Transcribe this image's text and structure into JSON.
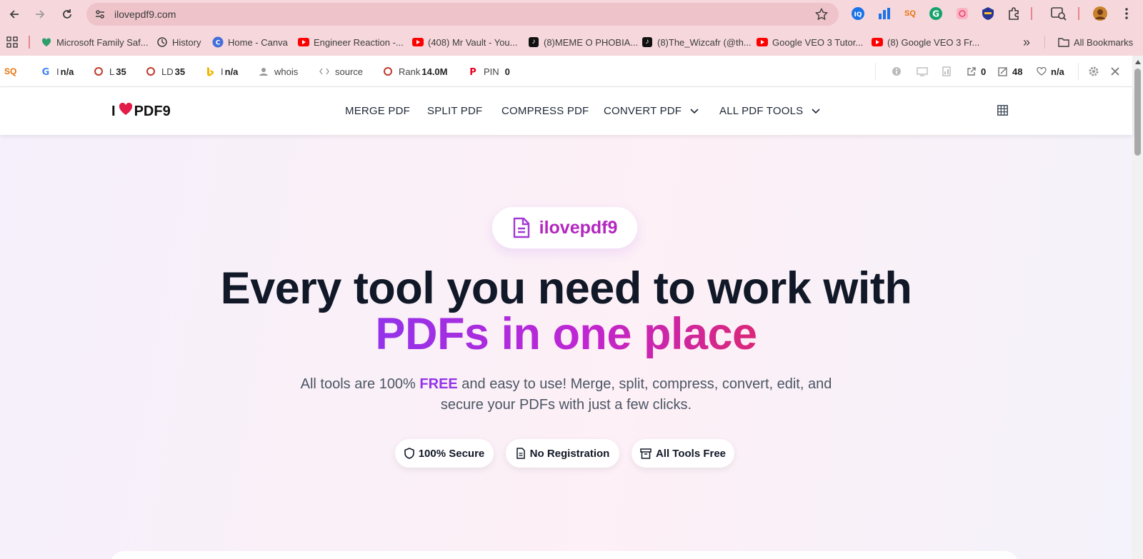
{
  "browser": {
    "url": "ilovepdf9.com",
    "bookmarks": [
      {
        "label": "Microsoft Family Saf...",
        "icon": "heart-shield-icon"
      },
      {
        "label": "History",
        "icon": "history-icon"
      },
      {
        "label": "Home - Canva",
        "icon": "canva-icon"
      },
      {
        "label": "Engineer Reaction -...",
        "icon": "youtube-icon"
      },
      {
        "label": "(408) Mr Vault - You...",
        "icon": "youtube-icon"
      },
      {
        "label": "(8)MEME O PHOBIA...",
        "icon": "tiktok-icon"
      },
      {
        "label": "(8)The_Wizcafr (@th...",
        "icon": "tiktok-icon"
      },
      {
        "label": "Google VEO 3 Tutor...",
        "icon": "youtube-icon"
      },
      {
        "label": "(8) Google VEO 3 Fr...",
        "icon": "youtube-icon"
      }
    ],
    "more_bookmarks": "»",
    "all_bookmarks": "All Bookmarks"
  },
  "seo_bar": {
    "items": [
      {
        "prefix": "I",
        "value": "n/a",
        "icon": "google-icon"
      },
      {
        "prefix": "L",
        "value": "35",
        "icon": "circle-icon"
      },
      {
        "prefix": "LD",
        "value": "35",
        "icon": "circle-icon"
      },
      {
        "prefix": "I",
        "value": "n/a",
        "icon": "bing-icon"
      },
      {
        "prefix": "whois",
        "value": "",
        "icon": "person-icon"
      },
      {
        "prefix": "source",
        "value": "",
        "icon": "code-icon"
      },
      {
        "prefix": "Rank",
        "value": "14.0M",
        "icon": "circle-icon"
      },
      {
        "prefix": "PIN",
        "value": "0",
        "icon": "pinterest-icon"
      }
    ],
    "right": {
      "external_links": "0",
      "internal_links": "48",
      "health": "n/a"
    }
  },
  "site": {
    "logo": {
      "before": "I",
      "after": "PDF9"
    },
    "nav": {
      "merge": "MERGE PDF",
      "split": "SPLIT PDF",
      "compress": "COMPRESS PDF",
      "convert": "CONVERT PDF",
      "all_tools": "ALL PDF TOOLS"
    },
    "hero": {
      "pill_brand": "ilovepdf9",
      "headline_line1": "Every tool you need to work with",
      "headline_line2": "PDFs in one place",
      "sub_pre": "All tools are 100% ",
      "sub_free": "FREE",
      "sub_post": " and easy to use! Merge, split, compress, convert, edit, and",
      "sub_line2": "secure your PDFs with just a few clicks.",
      "badges": [
        "100% Secure",
        "No Registration",
        "All Tools Free"
      ]
    }
  },
  "colors": {
    "accent_purple": "#9333ea",
    "accent_pink": "#db2777",
    "heart": "#e11d48",
    "chrome": "#f6d8dc"
  }
}
